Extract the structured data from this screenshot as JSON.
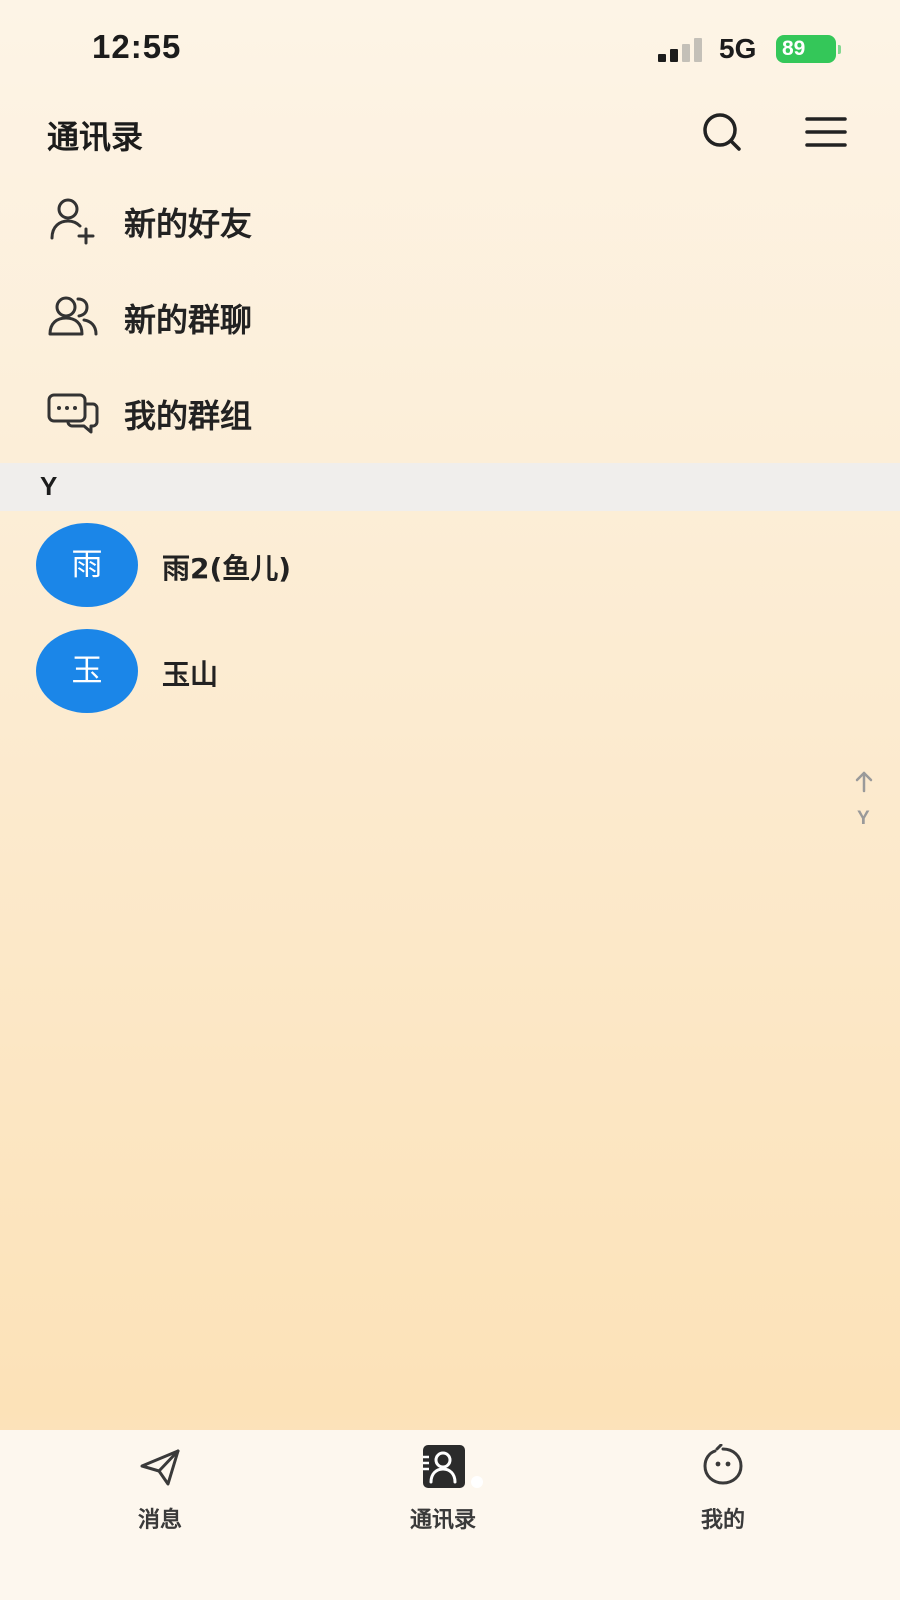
{
  "status_bar": {
    "time": "12:55",
    "network": "5G",
    "battery": "89"
  },
  "header": {
    "title": "通讯录",
    "search_icon": "search-icon",
    "menu_icon": "menu-icon"
  },
  "entries": [
    {
      "label": "新的好友",
      "icon": "add-user-icon"
    },
    {
      "label": "新的群聊",
      "icon": "group-icon"
    },
    {
      "label": "我的群组",
      "icon": "chat-bubbles-icon"
    }
  ],
  "section": {
    "letter": "Y"
  },
  "contacts": [
    {
      "avatar_text": "雨",
      "name": "雨2(鱼儿)"
    },
    {
      "avatar_text": "玉",
      "name": "玉山"
    }
  ],
  "index_bar": {
    "letters": [
      "Y"
    ]
  },
  "tabs": [
    {
      "label": "消息",
      "icon": "paper-plane-icon",
      "active": false
    },
    {
      "label": "通讯录",
      "icon": "contacts-icon",
      "active": true
    },
    {
      "label": "我的",
      "icon": "smile-bubble-icon",
      "active": false
    }
  ],
  "colors": {
    "avatar": "#1b86e8",
    "battery": "#34c759",
    "section_bg": "#f0eeec"
  }
}
